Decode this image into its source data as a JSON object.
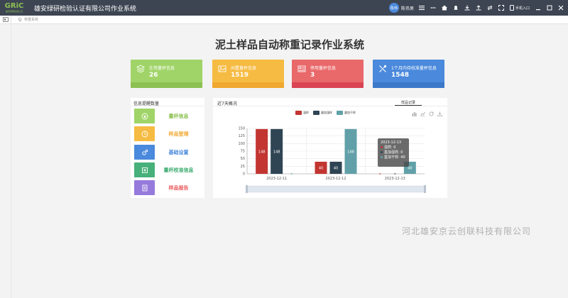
{
  "header": {
    "logo_text": "GRiC",
    "logo_sub": "雄安绿研检验认证",
    "app_title": "雄安绿研检验认证有限公司作业系统",
    "avatar_text": "陈伟",
    "username": "陈伟男",
    "mobile_label": "手机入口"
  },
  "breadcrumb": {
    "current": "称重系统"
  },
  "page_title": "泥土样品自动称重记录作业系统",
  "cards": [
    {
      "label": "在用量杯信息",
      "value": "26",
      "color": "#a0d468",
      "strip": "#8cc152"
    },
    {
      "label": "闲置量杯信息",
      "value": "1519",
      "color": "#f6bb42",
      "strip": "#f0a830"
    },
    {
      "label": "停用量杯信息",
      "value": "3",
      "color": "#e9686a",
      "strip": "#da4453"
    },
    {
      "label": "1个月内待校准量杯信息",
      "value": "1548",
      "color": "#4a89dc",
      "strip": "#3b78c9"
    }
  ],
  "info_panel": {
    "title": "信息提醒数量",
    "items": [
      {
        "label": "量杯信息",
        "color": "#a0d468",
        "text_color": "#8cc152",
        "icon": "cup-icon"
      },
      {
        "label": "样品登理",
        "color": "#f6bb42",
        "text_color": "#f0a830",
        "icon": "sample-icon"
      },
      {
        "label": "基础设置",
        "color": "#4a89dc",
        "text_color": "#4a89dc",
        "icon": "settings-icon"
      },
      {
        "label": "量杯校准信息",
        "color": "#48b07a",
        "text_color": "#3bab6f",
        "icon": "calibrate-icon"
      },
      {
        "label": "样品报告",
        "color": "#967adc",
        "text_color": "#e9575b",
        "icon": "report-icon"
      }
    ]
  },
  "chart_panel": {
    "title": "近7天概况",
    "tab": "样品记录"
  },
  "chart_data": {
    "type": "bar",
    "categories": [
      "2023-12-11",
      "2023-12-12",
      "2023-12-13"
    ],
    "series": [
      {
        "name": "湿样",
        "color": "#c23531",
        "values": [
          148,
          40,
          0
        ]
      },
      {
        "name": "盒加湿样",
        "color": "#2f4554",
        "values": [
          148,
          40,
          0
        ]
      },
      {
        "name": "盒加干样",
        "color": "#61a0a8",
        "values": [
          0,
          148,
          40
        ]
      }
    ],
    "ylim": [
      0,
      150
    ],
    "yticks": [
      0,
      25,
      50,
      75,
      100,
      125,
      150
    ],
    "grid": true,
    "legend_position": "top-center"
  },
  "tooltip": {
    "date": "2023-12-13",
    "rows": [
      {
        "text": "湿样: 0",
        "color": "#c23531"
      },
      {
        "text": "盒加湿样: 0",
        "color": "#2f4554"
      },
      {
        "text": "盒加干样: 40",
        "color": "#61a0a8"
      }
    ]
  },
  "watermark": "河北雄安京云创联科技有限公司"
}
